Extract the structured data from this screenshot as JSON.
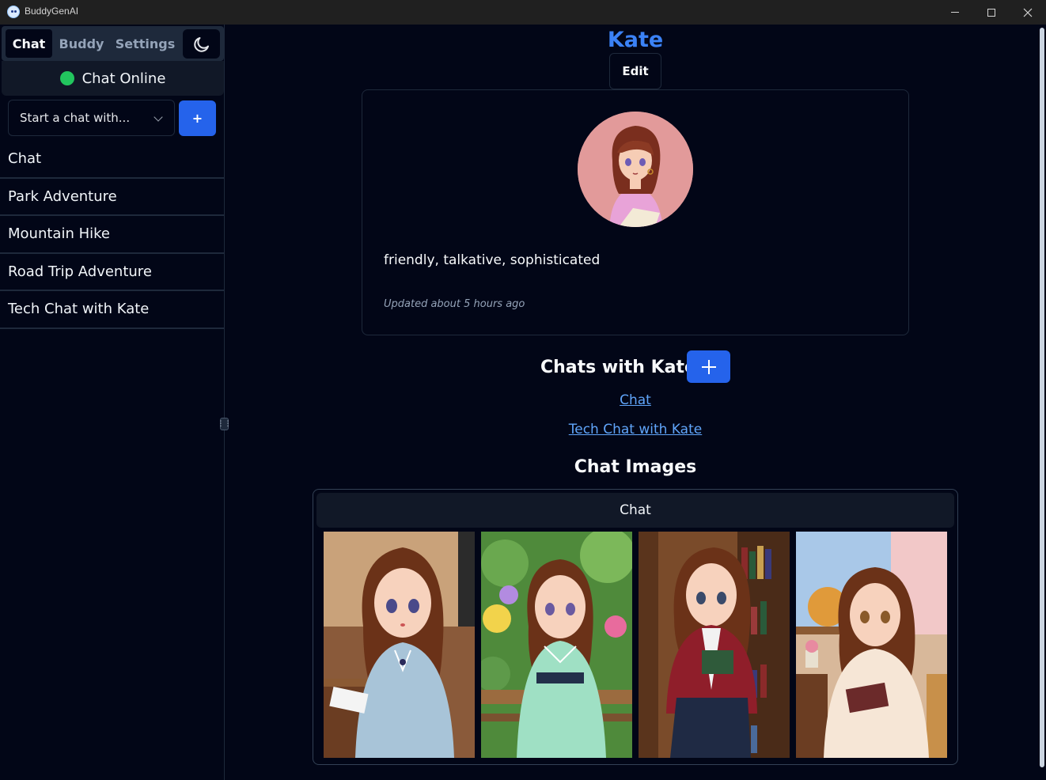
{
  "window": {
    "title": "BuddyGenAI",
    "controls": {
      "minimize": "minimize-icon",
      "maximize": "maximize-icon",
      "close": "close-icon"
    }
  },
  "sidebar": {
    "tabs": [
      {
        "label": "Chat",
        "active": true
      },
      {
        "label": "Buddy",
        "active": false
      },
      {
        "label": "Settings",
        "active": false
      }
    ],
    "theme_toggle_icon": "moon-icon",
    "status": {
      "label": "Chat Online",
      "color": "#22c55e"
    },
    "start_chat": {
      "placeholder": "Start a chat with...",
      "add_label": "+"
    },
    "chats": [
      "Chat",
      "Park Adventure",
      "Mountain Hike",
      "Road Trip Adventure",
      "Tech Chat with Kate"
    ]
  },
  "profile": {
    "name": "Kate",
    "edit_label": "Edit",
    "traits": "friendly, talkative, sophisticated",
    "updated": "Updated about 5 hours ago"
  },
  "chats_section": {
    "heading": "Chats with Kate",
    "links": [
      "Chat",
      "Tech Chat with Kate"
    ]
  },
  "images_section": {
    "heading": "Chat Images",
    "tab_label": "Chat",
    "images": [
      {
        "name": "kate-classroom-image"
      },
      {
        "name": "kate-garden-bench-image"
      },
      {
        "name": "kate-library-image"
      },
      {
        "name": "kate-reading-window-image"
      }
    ]
  },
  "colors": {
    "accent": "#2563eb",
    "link": "#60a5fa",
    "name": "#3b82f6",
    "background": "#020617"
  }
}
